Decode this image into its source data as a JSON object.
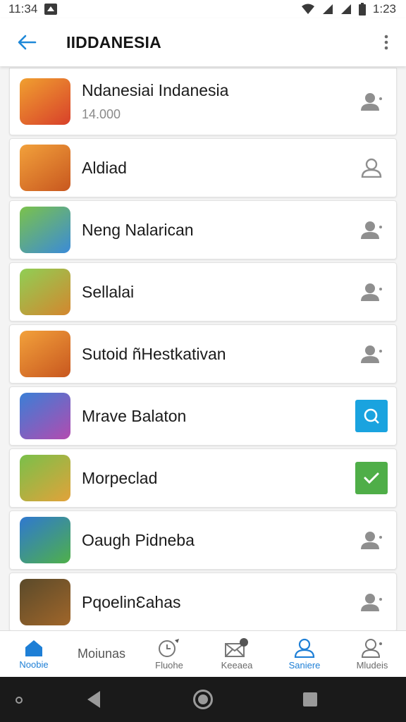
{
  "status_bar": {
    "time_left": "11:34",
    "time_right": "1:23"
  },
  "app_bar": {
    "title": "IIDDANESIA"
  },
  "apps": [
    {
      "title": "Ndanesiai Indanesia",
      "subtitle": "14.000",
      "action_icon": "person-add-icon",
      "icon_colors": [
        "#f0a030",
        "#d8402a"
      ]
    },
    {
      "title": "Aldiad",
      "subtitle": "",
      "action_icon": "person-icon",
      "icon_colors": [
        "#f2a13b",
        "#c8571f"
      ]
    },
    {
      "title": "Neng Nalarican",
      "subtitle": "",
      "action_icon": "person-add-icon",
      "icon_colors": [
        "#7bc24a",
        "#3b8bd8"
      ]
    },
    {
      "title": "Sellalai",
      "subtitle": "",
      "action_icon": "person-add-icon",
      "icon_colors": [
        "#8fcf55",
        "#d4862e"
      ]
    },
    {
      "title": "Sutoid ñHestkativan",
      "subtitle": "",
      "action_icon": "person-add-icon",
      "icon_colors": [
        "#f2a13b",
        "#c8571f"
      ]
    },
    {
      "title": "Mrave Balaton",
      "subtitle": "",
      "action_icon": "search-icon",
      "icon_colors": [
        "#3a7fd6",
        "#b34bb0"
      ]
    },
    {
      "title": "Morpeclad",
      "subtitle": "",
      "action_icon": "check-icon",
      "icon_colors": [
        "#79c04a",
        "#e2a23a"
      ]
    },
    {
      "title": "Oaugh Pidneba",
      "subtitle": "",
      "action_icon": "person-add-icon",
      "icon_colors": [
        "#2f78d0",
        "#4fb04a"
      ]
    },
    {
      "title": "PqoelinƐahas",
      "subtitle": "",
      "action_icon": "person-add-icon",
      "icon_colors": [
        "#5a4a2a",
        "#a0662a"
      ]
    }
  ],
  "bottom_nav": [
    {
      "label": "Noobie",
      "icon": "home-icon",
      "active": true
    },
    {
      "label": "Moiunas",
      "icon": "",
      "active": false
    },
    {
      "label": "Fluohe",
      "icon": "alarm-icon",
      "active": false
    },
    {
      "label": "Keeaea",
      "icon": "mail-icon",
      "active": false
    },
    {
      "label": "Saniere",
      "icon": "person-icon",
      "active": true
    },
    {
      "label": "Mludeis",
      "icon": "person-add-icon",
      "active": false
    }
  ],
  "colors": {
    "accent": "#1e7fd6",
    "badge_blue": "#1aa3df",
    "badge_green": "#4fae48"
  }
}
